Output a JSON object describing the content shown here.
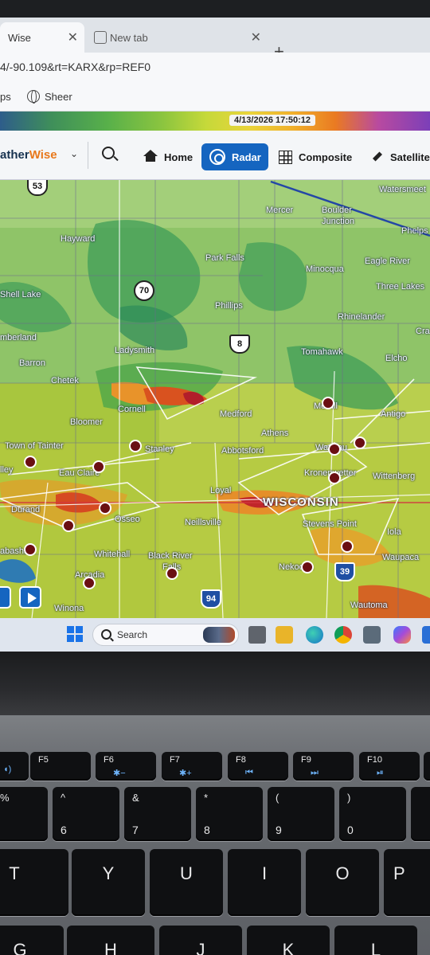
{
  "browser": {
    "active_tab_title": "Wise",
    "inactive_tab_title": "New tab",
    "close_glyph": "✕",
    "new_tab_glyph": "+",
    "url": "4/-90.109&rt=KARX&rp=REF0",
    "bookmarks": [
      {
        "label": "ps"
      },
      {
        "label": "Sheer"
      }
    ]
  },
  "radar": {
    "timestamp": "4/13/2026 17:50:12"
  },
  "app": {
    "brand_prefix": "ather",
    "brand_suffix": "Wise",
    "brand_caret": "⌄",
    "nav": [
      {
        "label": "Home",
        "icon": "home-icon",
        "active": false
      },
      {
        "label": "Radar",
        "icon": "radar-icon",
        "active": true
      },
      {
        "label": "Composite",
        "icon": "grid-icon",
        "active": false
      },
      {
        "label": "Satellite",
        "icon": "satellite-icon",
        "active": false
      }
    ],
    "accent_color": "#1565c0",
    "brand_color": "#e8791c"
  },
  "map": {
    "places": [
      {
        "name": "Watersmeet"
      },
      {
        "name": "Mercer"
      },
      {
        "name": "Boulder"
      },
      {
        "name": "Junction"
      },
      {
        "name": "Phelps"
      },
      {
        "name": "Hayward"
      },
      {
        "name": "Park Falls"
      },
      {
        "name": "Minocqua"
      },
      {
        "name": "Eagle River"
      },
      {
        "name": "Three Lakes"
      },
      {
        "name": "Shell Lake"
      },
      {
        "name": "Phillips"
      },
      {
        "name": "Rhinelander"
      },
      {
        "name": "Cra"
      },
      {
        "name": "mberland"
      },
      {
        "name": "Ladysmith"
      },
      {
        "name": "Tomahawk"
      },
      {
        "name": "Barron"
      },
      {
        "name": "Elcho"
      },
      {
        "name": "Chetek"
      },
      {
        "name": "Cornell"
      },
      {
        "name": "Medford"
      },
      {
        "name": "Merrill"
      },
      {
        "name": "Antigo"
      },
      {
        "name": "Bloomer"
      },
      {
        "name": "Athens"
      },
      {
        "name": "Town of Tainter"
      },
      {
        "name": "Stanley"
      },
      {
        "name": "Abbotsford"
      },
      {
        "name": "Wausau"
      },
      {
        "name": "lley"
      },
      {
        "name": "Eau Claire"
      },
      {
        "name": "Kronenwetter"
      },
      {
        "name": "Wittenberg"
      },
      {
        "name": "Loyal"
      },
      {
        "name": "WISCONSIN"
      },
      {
        "name": "Durand"
      },
      {
        "name": "Osseo"
      },
      {
        "name": "Neillsville"
      },
      {
        "name": "Stevens Point"
      },
      {
        "name": "Iola"
      },
      {
        "name": "Waupaca"
      },
      {
        "name": "Whitehall"
      },
      {
        "name": "Black River"
      },
      {
        "name": "Falls"
      },
      {
        "name": "Nekoosa"
      },
      {
        "name": "Arcadia"
      },
      {
        "name": "Winona"
      },
      {
        "name": "Wautoma"
      },
      {
        "name": "abasha"
      }
    ],
    "routes": [
      {
        "label": "53",
        "kind": "us"
      },
      {
        "label": "70",
        "kind": "state"
      },
      {
        "label": "8",
        "kind": "us"
      },
      {
        "label": "94",
        "kind": "interstate"
      },
      {
        "label": "39",
        "kind": "interstate"
      }
    ]
  },
  "taskbar": {
    "search_label": "Search",
    "pinned": [
      "task-view-icon",
      "file-explorer-icon",
      "edge-icon",
      "chrome-icon",
      "store-icon",
      "copilot-icon",
      "app-icon"
    ]
  },
  "keyboard": {
    "function_row": [
      {
        "label": "F5",
        "icon": "mic-icon"
      },
      {
        "label": "F6",
        "icon": "brightness-down-icon"
      },
      {
        "label": "F7",
        "icon": "brightness-up-icon"
      },
      {
        "label": "F8",
        "icon": "previous-track-icon"
      },
      {
        "label": "F9",
        "icon": "next-track-icon"
      },
      {
        "label": "F10",
        "icon": "play-pause-icon"
      }
    ],
    "number_row": [
      {
        "top": "%",
        "bottom": ""
      },
      {
        "top": "^",
        "bottom": "6"
      },
      {
        "top": "&",
        "bottom": "7"
      },
      {
        "top": "*",
        "bottom": "8"
      },
      {
        "top": "(",
        "bottom": "9"
      },
      {
        "top": ")",
        "bottom": "0"
      }
    ],
    "letter_row": [
      "T",
      "Y",
      "U",
      "I",
      "O",
      "P"
    ],
    "bottom_row": [
      "G",
      "H",
      "J",
      "K",
      "L"
    ]
  }
}
